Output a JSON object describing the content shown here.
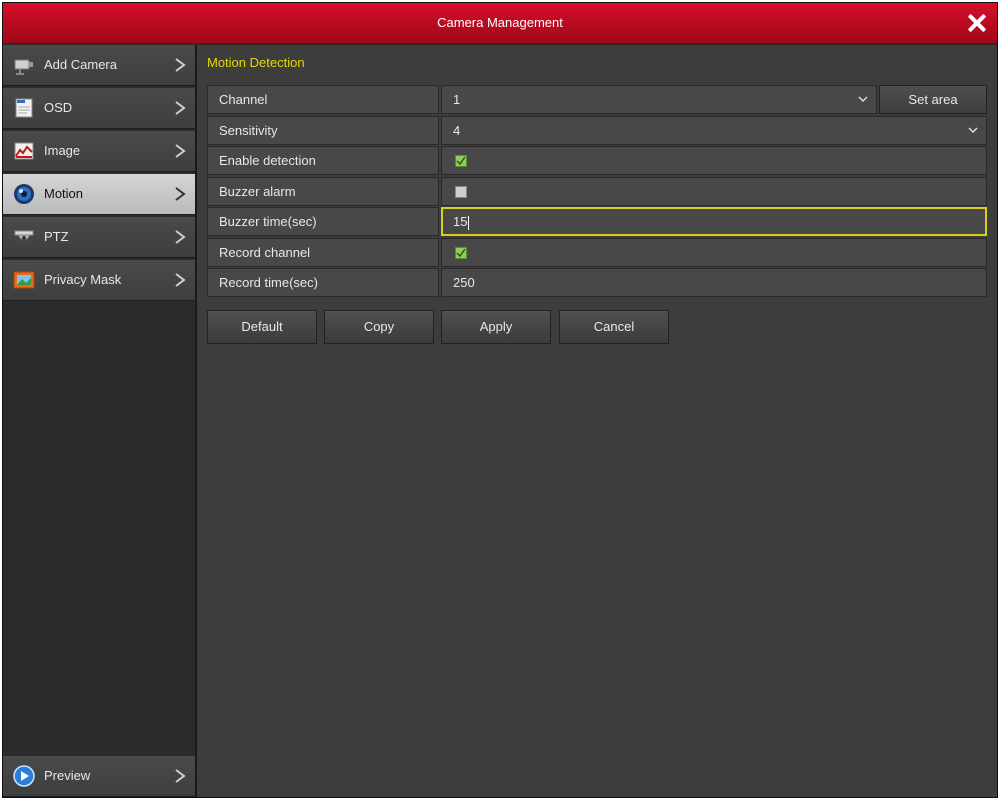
{
  "window": {
    "title": "Camera Management"
  },
  "sidebar": {
    "items": [
      {
        "label": "Add Camera",
        "icon": "camera-icon"
      },
      {
        "label": "OSD",
        "icon": "osd-icon"
      },
      {
        "label": "Image",
        "icon": "image-icon"
      },
      {
        "label": "Motion",
        "icon": "motion-icon",
        "active": true
      },
      {
        "label": "PTZ",
        "icon": "ptz-camera-icon"
      },
      {
        "label": "Privacy Mask",
        "icon": "privacy-mask-icon"
      }
    ],
    "bottom": {
      "label": "Preview",
      "icon": "play-icon"
    }
  },
  "main": {
    "section_title": "Motion Detection",
    "fields": {
      "channel": {
        "label": "Channel",
        "value": "1"
      },
      "set_area": "Set area",
      "sensitivity": {
        "label": "Sensitivity",
        "value": "4"
      },
      "enable_detection": {
        "label": "Enable detection",
        "checked": true
      },
      "buzzer_alarm": {
        "label": "Buzzer alarm",
        "checked": false
      },
      "buzzer_time": {
        "label": "Buzzer time(sec)",
        "value": "15"
      },
      "record_channel": {
        "label": "Record channel",
        "checked": true
      },
      "record_time": {
        "label": "Record time(sec)",
        "value": "250"
      }
    },
    "buttons": {
      "default": "Default",
      "copy": "Copy",
      "apply": "Apply",
      "cancel": "Cancel"
    }
  },
  "colors": {
    "titlebar": "#c40c22",
    "accent_title": "#e6d800",
    "focus_border": "#d9cf1a",
    "check_on": "#8fcc5a"
  }
}
